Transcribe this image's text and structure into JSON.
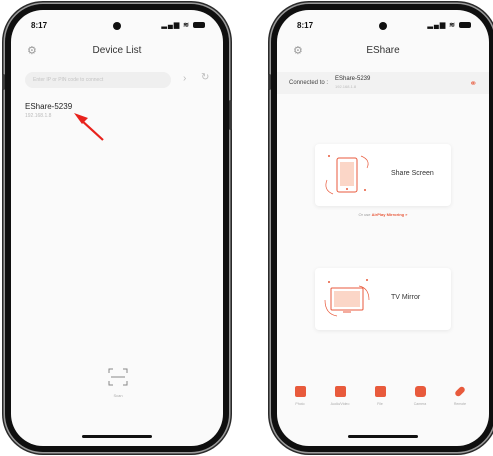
{
  "left_phone": {
    "status_time": "8:17",
    "title": "Device List",
    "search_placeholder": "Enter IP or PIN code to connect",
    "arrow_glyph": "›",
    "device": {
      "name": "EShare-5239",
      "ip": "192.168.1.8"
    },
    "scan_label": "Scan"
  },
  "right_phone": {
    "status_time": "8:17",
    "title": "EShare",
    "connected_label": "Connected to :",
    "connected_name": "EShare-5239",
    "connected_ip": "192.168.1.8",
    "share_screen_label": "Share Screen",
    "airplay_prefix": "Or use",
    "airplay_link": "AirPlay Mirroring »",
    "tv_mirror_label": "TV Mirror",
    "toolbar": [
      {
        "label": "Photo",
        "icon": "photo-icon"
      },
      {
        "label": "Audio/Video",
        "icon": "video-icon"
      },
      {
        "label": "File",
        "icon": "folder-icon"
      },
      {
        "label": "Camera",
        "icon": "camera-icon"
      },
      {
        "label": "Remote",
        "icon": "remote-icon"
      }
    ]
  },
  "colors": {
    "accent": "#e85a3c",
    "arrow": "#e8221c",
    "frame": "#0f0f0f"
  }
}
